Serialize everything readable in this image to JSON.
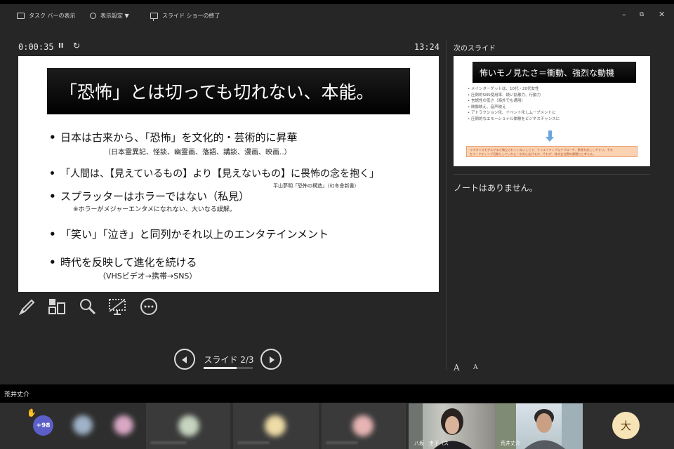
{
  "toolbar": {
    "taskbar_label": "タスク バーの表示",
    "display_settings_label": "表示設定 ▼",
    "end_show_label": "スライド ショーの終了",
    "minimize_glyph": "–",
    "restore_glyph": "⧉",
    "close_glyph": "✕"
  },
  "presenter": {
    "elapsed_time": "0:00:35",
    "pause_glyph": "II",
    "restart_glyph": "↻",
    "clock": "13:24"
  },
  "current_slide": {
    "title": "「恐怖」とは切っても切れない、本能。",
    "bullet_glyph": "•",
    "bullets": [
      "日本は古来から、「恐怖」を文化的・芸術的に昇華",
      "「人間は、【見えているもの】より【見えないもの】に畏怖の念を抱く」",
      "スプラッターはホラーではない（私見）",
      "「笑い」「泣き」と同列かそれ以上のエンタテインメント",
      "時代を反映して進化を続ける"
    ],
    "sub1": "（日本霊異記、怪談、幽霊画、落語、講談、漫画、映画‥）",
    "citation": "平山夢明「恐怖の構造」（幻冬舎新書）",
    "sub3": "※ホラーがメジャーエンタメになれない、大いなる誤解。",
    "sub5": "（VHSビデオ→携帯→SNS）"
  },
  "tools": [
    "pen-tool",
    "see-all-slides",
    "zoom-magnifier",
    "black-white-screen",
    "more-options"
  ],
  "navigation": {
    "counter": "スライド 2/3",
    "progress": 0.667
  },
  "next_slide": {
    "label": "次のスライド",
    "title": "怖いモノ見たさ＝衝動、強烈な動機",
    "bullets": [
      "メインターゲットは、10代・20代女性",
      "圧倒的SNS使用率、続い拡散力、行動力",
      "言語性の低さ（海外でも通用）",
      "映像映え、音声映え",
      "アトラクション化、イベント化しムーブメントに",
      "圧倒的なエモーショナル体験をビジネスチャンスに"
    ],
    "box_lines": [
      "マネタイズモデルがまだ確立されていないことで、クリエイティブなアプローチ、動画を起こしやすい。それ",
      "をマーケティング活動としていかに一歩先に広げるか、それが、株式会社闇の課題だと考える。"
    ]
  },
  "notes": {
    "text": "ノートはありません。",
    "font_larger": "A",
    "font_smaller": "A"
  },
  "meeting": {
    "presenter_name": "荒井丈介",
    "raise_hand_glyph": "✋",
    "overflow_count": "+98",
    "video1_label": "八坂　圭子（ス",
    "video2_label": "荒井丈介",
    "avatar_initial": "大",
    "colors": {
      "overflow_badge": "#5b5fc7",
      "avatar_bg": "#f6e3b6"
    }
  }
}
